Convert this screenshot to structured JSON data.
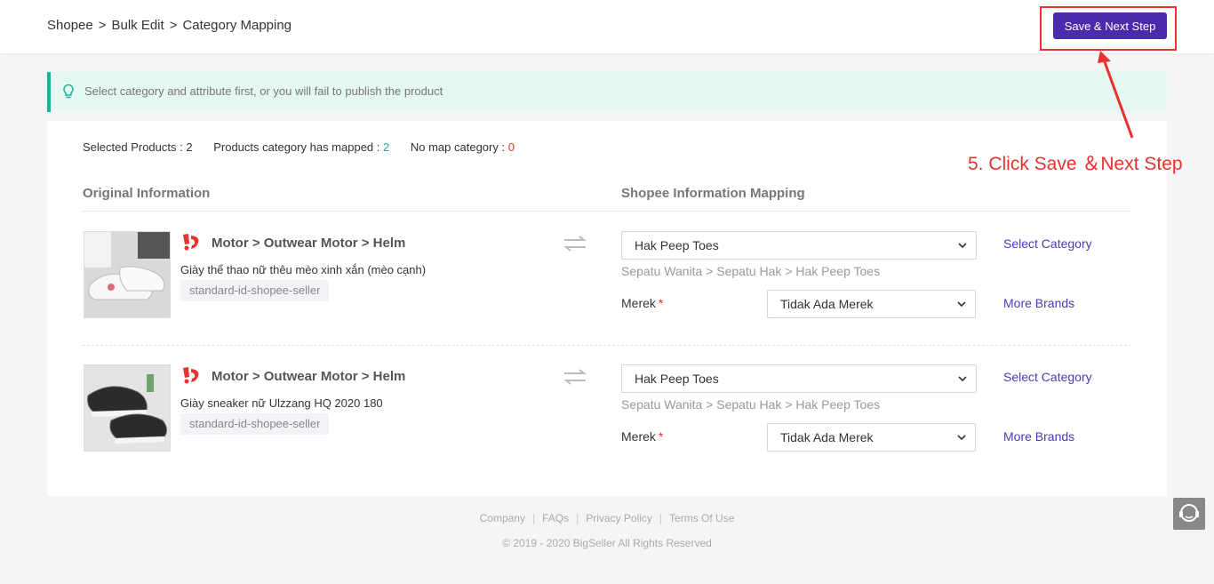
{
  "breadcrumb": {
    "part1": "Shopee",
    "sep1": ">",
    "part2": "Bulk Edit",
    "sep2": ">",
    "part3": "Category Mapping"
  },
  "header": {
    "save_label": "Save & Next Step"
  },
  "notice": {
    "text": "Select category and attribute first, or you will fail to publish the product"
  },
  "summary": {
    "selected_label": "Selected Products :",
    "selected_value": "2",
    "mapped_label": "Products category has mapped :",
    "mapped_value": "2",
    "nomap_label": "No map category :",
    "nomap_value": "0"
  },
  "columns": {
    "original": "Original Information",
    "mapping": "Shopee Information Mapping"
  },
  "products": [
    {
      "category_path": "Motor > Outwear Motor > Helm",
      "name": "Giày thể thao nữ thêu mèo xinh xắn (mèo cạnh)",
      "sku": "standard-id-shopee-seller",
      "shopee_category": "Hak Peep Toes",
      "shopee_path": "Sepatu Wanita > Sepatu Hak > Hak Peep Toes",
      "merek_label": "Merek",
      "merek_required": "*",
      "merek_value": "Tidak Ada Merek",
      "select_category_label": "Select Category",
      "more_brands_label": "More Brands"
    },
    {
      "category_path": "Motor > Outwear Motor > Helm",
      "name": "Giày sneaker nữ Ulzzang HQ 2020 180",
      "sku": "standard-id-shopee-seller",
      "shopee_category": "Hak Peep Toes",
      "shopee_path": "Sepatu Wanita > Sepatu Hak > Hak Peep Toes",
      "merek_label": "Merek",
      "merek_required": "*",
      "merek_value": "Tidak Ada Merek",
      "select_category_label": "Select Category",
      "more_brands_label": "More Brands"
    }
  ],
  "annotation": {
    "text": "5. Click Save ＆Next Step"
  },
  "footer": {
    "links": [
      "Company",
      "FAQs",
      "Privacy Policy",
      "Terms Of Use"
    ],
    "copyright": "© 2019 - 2020 BigSeller All Rights Reserved"
  },
  "colors": {
    "accent": "#4a2bab",
    "teal": "#17b394",
    "annotation_red": "#e8322e",
    "link": "#4a3bb5"
  },
  "icons": {
    "notice": "lightbulb-icon",
    "swap": "swap-arrows-icon",
    "help": "customer-service-icon",
    "brand": "shopee-logo-icon"
  }
}
